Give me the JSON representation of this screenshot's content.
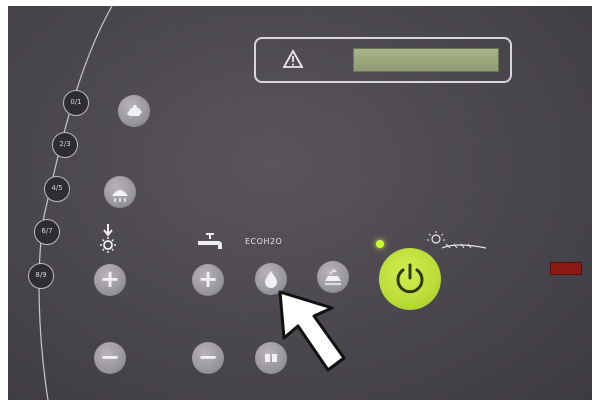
{
  "panel": {
    "program_buttons": [
      "0/1",
      "2/3",
      "4/5",
      "6/7",
      "8/9"
    ],
    "display": {
      "warning_icon": "warning-triangle-icon"
    },
    "eco_label": "ECOH2O",
    "icons": {
      "temperature": "sun-arrow-down-icon",
      "water": "tap-icon",
      "drop": "water-drop-icon",
      "wash": "wash-symbol-icon",
      "power": "power-icon",
      "pointer": "arrow-cursor-icon"
    },
    "colors": {
      "panel": "#4a464d",
      "power_button": "#b9dc37",
      "indicator_led": "#8b1a14"
    }
  }
}
